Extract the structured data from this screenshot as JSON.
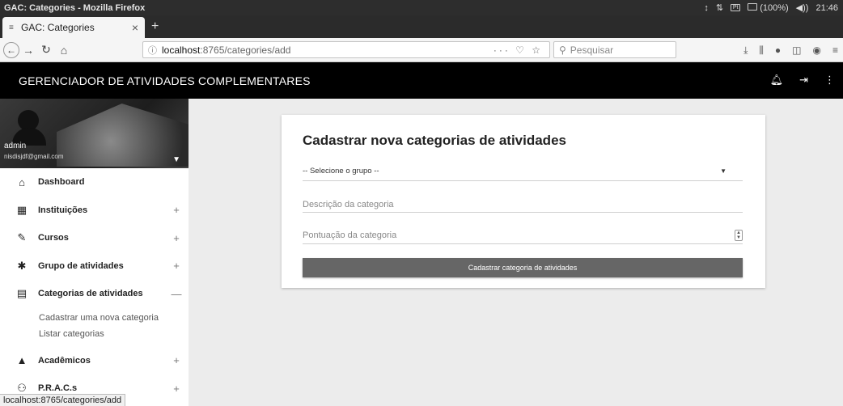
{
  "os": {
    "title": "GAC: Categories - Mozilla Firefox",
    "tray": [
      "↕",
      "⇅",
      "Pt",
      "(100%)",
      "◀))",
      "21:46"
    ]
  },
  "browser": {
    "tab_label": "GAC: Categories",
    "url_host": "localhost",
    "url_path": ":8765/categories/add",
    "search_placeholder": "Pesquisar",
    "url_actions": "··· ♡ ☆",
    "status_url": "localhost:8765/categories/add"
  },
  "app": {
    "title": "GERENCIADOR DE ATIVIDADES COMPLEMENTARES"
  },
  "user": {
    "name": "admin",
    "email": "nisdisjdf@gmail.com"
  },
  "menu": {
    "dashboard": "Dashboard",
    "instituicoes": "Instituições",
    "cursos": "Cursos",
    "grupo": "Grupo de atividades",
    "categorias": "Categorias de atividades",
    "sub_cadastrar": "Cadastrar uma nova categoria",
    "sub_listar": "Listar categorias",
    "academicos": "Acadêmicos",
    "pracs": "P.R.A.C.s",
    "plus": "+",
    "minus": "—"
  },
  "form": {
    "title": "Cadastrar nova categorias de atividades",
    "select_value": "-- Selecione o grupo --",
    "desc_placeholder": "Descrição da categoria",
    "pont_placeholder": "Pontuação da categoria",
    "submit_label": "Cadastrar categoria de atividades"
  },
  "colors": {
    "appbar": "#000000",
    "button": "#666666",
    "sidebar": "#ffffff",
    "content_bg": "#ececec"
  }
}
